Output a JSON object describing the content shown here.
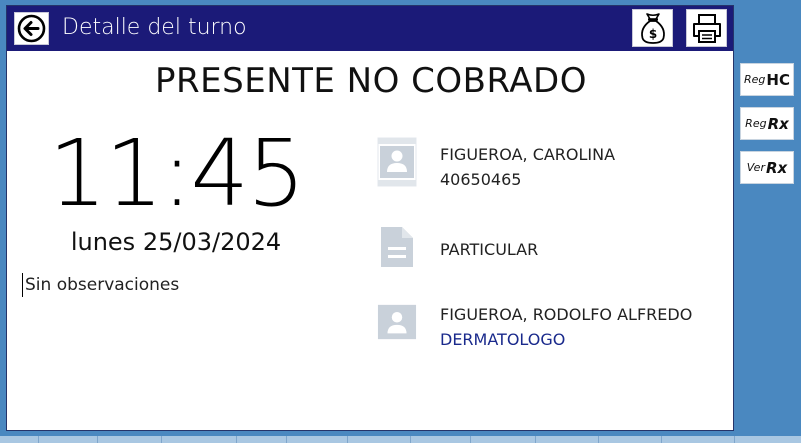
{
  "window": {
    "title": "Detalle del turno"
  },
  "toolbar": {
    "back_icon": "arrow-left-circle-icon",
    "charge_icon": "money-bag-icon",
    "print_icon": "printer-icon"
  },
  "appointment": {
    "status": "PRESENTE NO COBRADO",
    "time": "11:45",
    "date": "lunes 25/03/2024",
    "observations": "Sin observaciones"
  },
  "patient": {
    "name": "FIGUEROA, CAROLINA",
    "document": "40650465",
    "icon": "contact-card-icon"
  },
  "coverage": {
    "name": "PARTICULAR",
    "icon": "document-icon"
  },
  "professional": {
    "name": "FIGUEROA, RODOLFO ALFREDO",
    "specialty": "DERMATOLOGO",
    "icon": "contact-card-icon"
  },
  "sidebar": {
    "reg_hc": {
      "small": "Reg",
      "big": "HC"
    },
    "reg_rx": {
      "small": "Reg",
      "big": "Rx"
    },
    "ver_rx": {
      "small": "Ver",
      "big": "Rx"
    }
  },
  "colors": {
    "titlebar": "#1b1a78",
    "background": "#4a88c0",
    "specialty_text": "#1a2a8c",
    "icon_gray": "#c9d1da"
  }
}
